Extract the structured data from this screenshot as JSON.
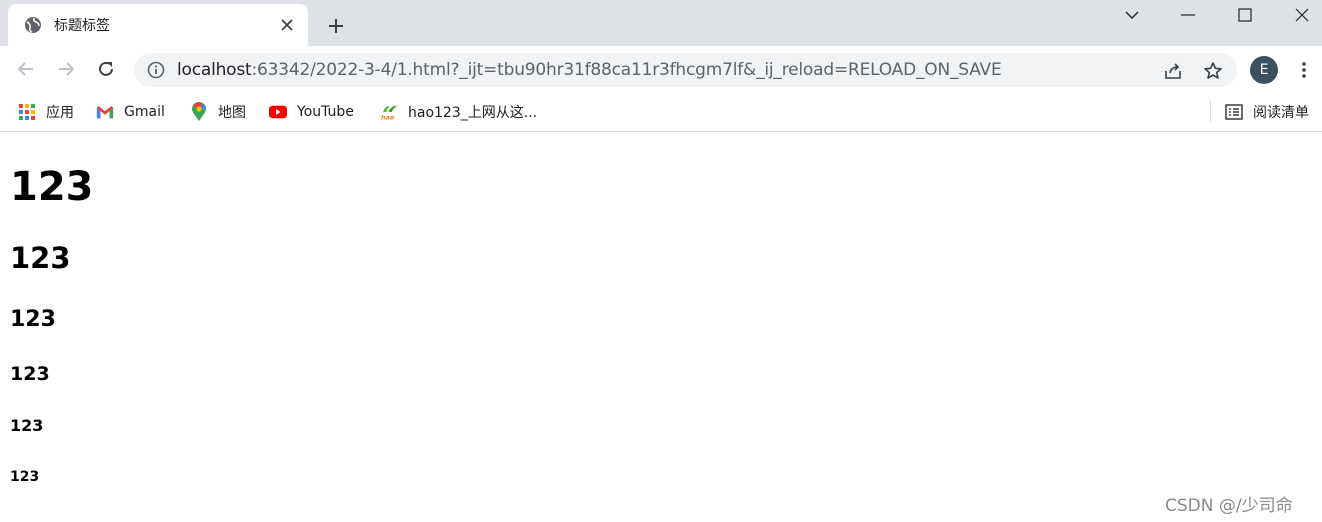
{
  "tab": {
    "title": "标题标签",
    "favicon": "globe-icon"
  },
  "toolbar": {
    "url_host": "localhost",
    "url_rest": ":63342/2022-3-4/1.html?_ijt=tbu90hr31f88ca11r3fhcgm7lf&_ij_reload=RELOAD_ON_SAVE",
    "avatar_letter": "E"
  },
  "bookmarks": {
    "items": [
      {
        "label": "应用",
        "icon": "apps-grid-icon"
      },
      {
        "label": "Gmail",
        "icon": "gmail-icon"
      },
      {
        "label": "地图",
        "icon": "maps-pin-icon"
      },
      {
        "label": "YouTube",
        "icon": "youtube-icon"
      },
      {
        "label": "hao123_上网从这...",
        "icon": "hao123-icon"
      }
    ],
    "reading_list": "阅读清单"
  },
  "content": {
    "headings": [
      "123",
      "123",
      "123",
      "123",
      "123",
      "123"
    ]
  },
  "watermark": "CSDN @/少司命",
  "colors": {
    "tabstrip": "#dee1e6",
    "omnibox": "#f1f3f4",
    "avatar": "#3c5160",
    "youtube": "#ff0000"
  }
}
